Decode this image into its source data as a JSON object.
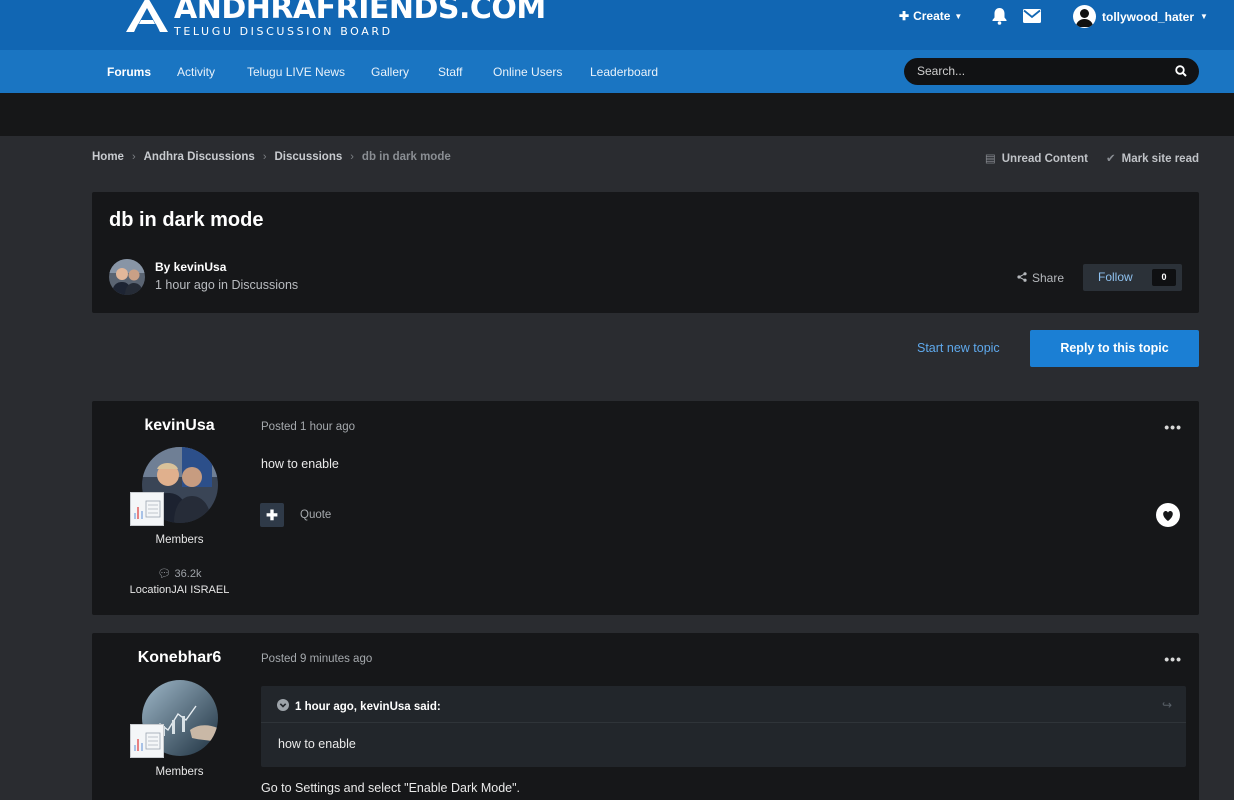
{
  "header": {
    "logo_main": "ANDHRAFRIENDS.COM",
    "logo_sub": "TELUGU DISCUSSION BOARD",
    "create_label": "Create",
    "username": "tollywood_hater"
  },
  "nav": {
    "items": [
      "Forums",
      "Activity",
      "Telugu LIVE News",
      "Gallery",
      "Staff",
      "Online Users",
      "Leaderboard"
    ],
    "active": "Forums",
    "search_placeholder": "Search..."
  },
  "breadcrumb": {
    "items": [
      "Home",
      "Andhra Discussions",
      "Discussions",
      "db in dark mode"
    ]
  },
  "page_actions": {
    "unread": "Unread Content",
    "mark_read": "Mark site read"
  },
  "topic": {
    "title": "db in dark mode",
    "by": "By kevinUsa",
    "time": "1 hour ago",
    "in_word": "in",
    "forum": "Discussions",
    "share_label": "Share",
    "follow_label": "Follow",
    "follow_count": "0"
  },
  "actions": {
    "start_topic": "Start new topic",
    "reply": "Reply to this topic"
  },
  "posts": [
    {
      "author": "kevinUsa",
      "group": "Members",
      "count": "36.2k",
      "location": "LocationJAI ISRAEL",
      "posted": "Posted 1 hour ago",
      "body": "how to enable",
      "quote_label": "Quote"
    },
    {
      "author": "Konebhar6",
      "group": "Members",
      "posted": "Posted 9 minutes ago",
      "quote_head": "1 hour ago, kevinUsa said:",
      "quote_body": "how to enable",
      "body": "Go to Settings and select \"Enable Dark Mode\"."
    }
  ],
  "colors": {
    "header_blue": "#1166b3",
    "nav_blue": "#1a75c2",
    "accent": "#1b7fd4",
    "panel": "#161719",
    "page_bg": "#2a2c30"
  }
}
